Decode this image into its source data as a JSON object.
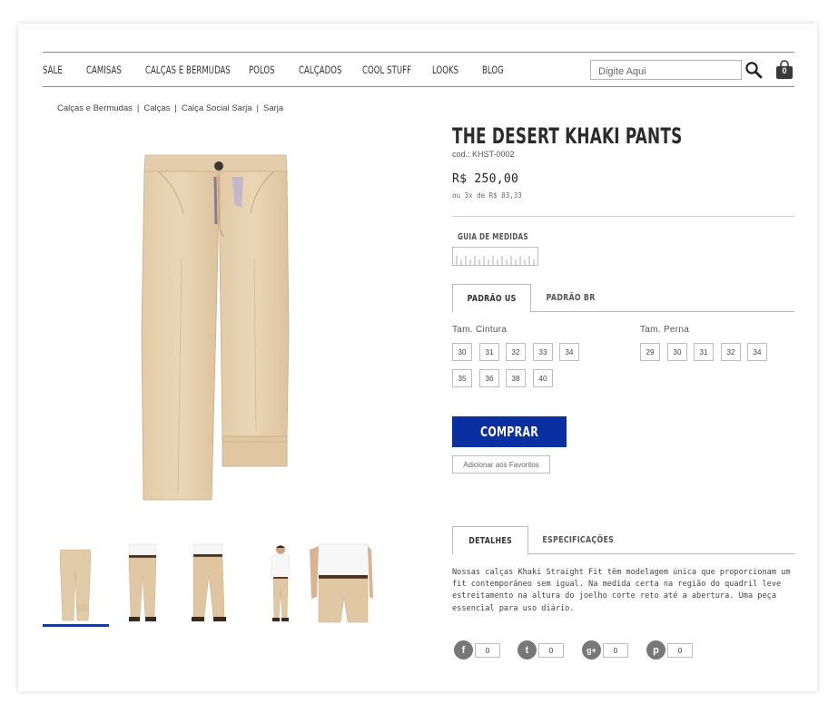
{
  "nav": {
    "items": [
      {
        "label": "SALE"
      },
      {
        "label": "CAMISAS"
      },
      {
        "label": "CALÇAS E BERMUDAS"
      },
      {
        "label": "POLOS"
      },
      {
        "label": "CALÇADOS"
      },
      {
        "label": "COOL STUFF"
      },
      {
        "label": "LOOKS"
      },
      {
        "label": "BLOG"
      }
    ],
    "search_placeholder": "Digite Aqui",
    "search_icon": "search-icon",
    "cart_icon": "shopping-bag-icon",
    "cart_count": "0"
  },
  "breadcrumb": {
    "items": [
      "Calças e Bermudas",
      "Calças",
      "Calça Social Sarja",
      "Sarja"
    ],
    "separator": "|"
  },
  "product": {
    "title": "THE DESERT KHAKI PANTS",
    "code": "cod.: KHST-0002",
    "price": "R$ 250,00",
    "installments": "ou 3x de R$ 83,33",
    "image_icon": "khaki-pants-image",
    "thumbnails": [
      {
        "name": "thumb-pants-flat"
      },
      {
        "name": "thumb-model-front"
      },
      {
        "name": "thumb-model-back"
      },
      {
        "name": "thumb-model-full"
      },
      {
        "name": "thumb-model-closeup"
      }
    ],
    "active_thumbnail": 0
  },
  "size_guide": {
    "label": "GUIA DE MEDIDAS",
    "icon": "ruler-icon"
  },
  "size_tabs": {
    "tabs": [
      {
        "label": "PADRÃO US"
      },
      {
        "label": "PADRÃO BR"
      }
    ],
    "active": 0
  },
  "sizes": {
    "waist_label": "Tam. Cintura",
    "waist": [
      "30",
      "31",
      "32",
      "33",
      "34",
      "35",
      "36",
      "38",
      "40"
    ],
    "leg_label": "Tam. Perna",
    "leg": [
      "29",
      "30",
      "31",
      "32",
      "34"
    ]
  },
  "actions": {
    "buy_label": "COMPRAR",
    "favorite_label": "Adicionar aos Favoritos"
  },
  "info_tabs": {
    "tabs": [
      {
        "label": "DETALHES"
      },
      {
        "label": "ESPECIFICAÇÕES"
      }
    ],
    "active": 0
  },
  "description": "Nossas calças Khaki Straight Fit têm modelagem única que proporcionam um fit contemporâneo sem igual. Na medida certa na região do quadril leve estreitamento na altura do joelho corte reto até a abertura. Uma peça essencial para uso diário.",
  "share": [
    {
      "network": "facebook",
      "glyph": "f",
      "count": "0"
    },
    {
      "network": "twitter",
      "glyph": "t",
      "count": "0"
    },
    {
      "network": "google-plus",
      "glyph": "g+",
      "count": "0"
    },
    {
      "network": "pinterest",
      "glyph": "p",
      "count": "0"
    }
  ],
  "colors": {
    "brand_blue": "#0a2fa0",
    "thumb_active": "#1a3a9a",
    "khaki": "#e6d0ae"
  }
}
